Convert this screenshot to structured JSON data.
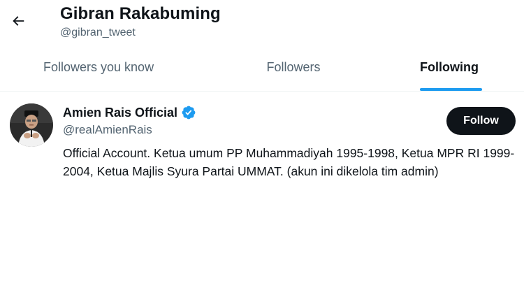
{
  "header": {
    "back_icon": "arrow-left-icon",
    "title": "Gibran Rakabuming",
    "handle": "@gibran_tweet"
  },
  "tabs": [
    {
      "label": "Followers you know",
      "active": false
    },
    {
      "label": "Followers",
      "active": false
    },
    {
      "label": "Following",
      "active": true
    }
  ],
  "users": [
    {
      "name": "Amien Rais Official",
      "verified": true,
      "handle": "@realAmienRais",
      "bio": "Official Account. Ketua umum PP Muhammadiyah 1995-1998, Ketua MPR RI 1999-2004, Ketua Majlis Syura Partai UMMAT. (akun ini dikelola tim admin)",
      "follow_label": "Follow"
    }
  ],
  "colors": {
    "accent": "#1d9bf0",
    "text_primary": "#0f1419",
    "text_secondary": "#536471",
    "button_bg": "#0f1419"
  }
}
